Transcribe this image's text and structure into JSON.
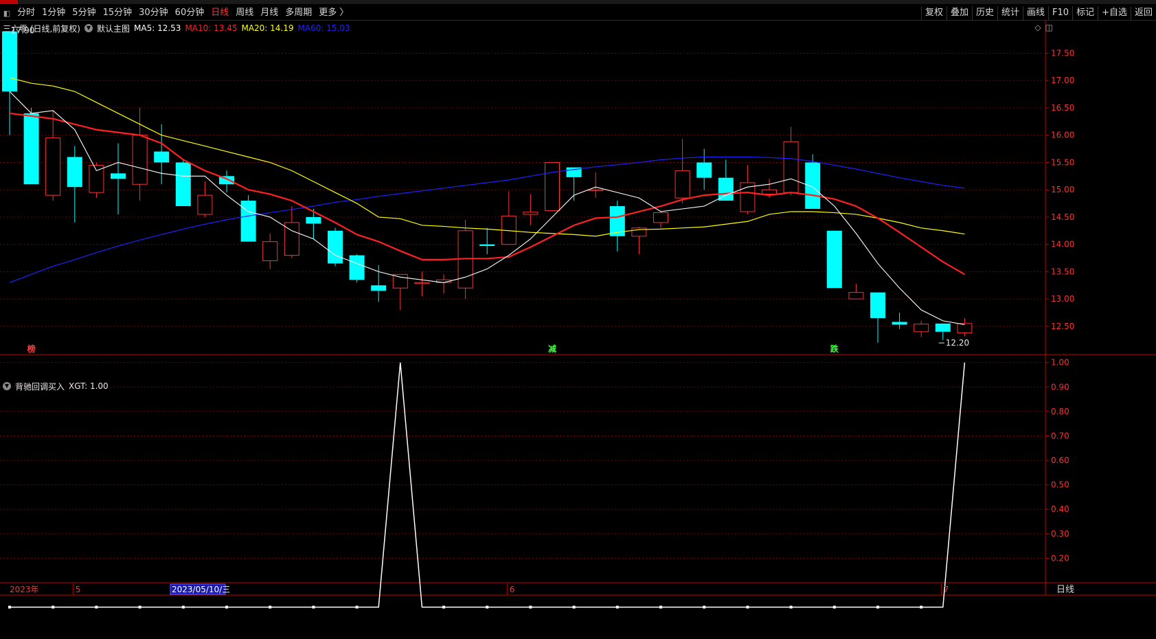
{
  "toolbar": {
    "periods": [
      "分时",
      "1分钟",
      "5分钟",
      "15分钟",
      "30分钟",
      "60分钟",
      "日线",
      "周线",
      "月线",
      "多周期",
      "更多 〉"
    ],
    "active_period": "日线",
    "right_buttons": [
      "复权",
      "叠加",
      "历史",
      "统计",
      "画线",
      "F10",
      "标记",
      "+自选",
      "返回"
    ]
  },
  "main_panel": {
    "stock_title": "三六零 (日线,前复权)",
    "template_label": "默认主图",
    "ma": [
      {
        "label": "MA5: 12.53",
        "color": "#ffffff"
      },
      {
        "label": "MA10: 13.45",
        "color": "#ff2020"
      },
      {
        "label": "MA20: 14.19",
        "color": "#ffff00"
      },
      {
        "label": "MA60: 15.03",
        "color": "#2020ff"
      }
    ],
    "high_label": "17.90",
    "low_label": "12.20",
    "markers": [
      {
        "text": "榜",
        "color": "#ff4040"
      },
      {
        "text": "减",
        "color": "#40ff40"
      },
      {
        "text": "跌",
        "color": "#40ff40"
      }
    ],
    "y_ticks": [
      "17.50",
      "17.00",
      "16.50",
      "16.00",
      "15.50",
      "15.00",
      "14.50",
      "14.00",
      "13.50",
      "13.00",
      "12.50"
    ]
  },
  "sub_panel": {
    "indicator_label": "背驰回调买入",
    "value_label": "XGT: 1.00",
    "y_ticks": [
      "1.00",
      "0.90",
      "0.80",
      "0.70",
      "0.60",
      "0.50",
      "0.40",
      "0.30",
      "0.20"
    ]
  },
  "x_axis": {
    "year_label": "2023年",
    "month_labels": [
      "5",
      "6",
      "7"
    ],
    "cursor_date": "2023/05/10/三",
    "period_label": "日线"
  },
  "colors": {
    "up": "#ff3030",
    "down": "#00ffff",
    "grid": "#7a0000",
    "axis": "#c00000"
  },
  "chart_data": {
    "type": "candlestick",
    "candles": [
      {
        "o": 17.9,
        "h": 17.9,
        "l": 16.0,
        "c": 16.8
      },
      {
        "o": 16.4,
        "h": 16.5,
        "l": 15.1,
        "c": 15.1
      },
      {
        "o": 14.9,
        "h": 16.45,
        "l": 14.8,
        "c": 15.95
      },
      {
        "o": 15.6,
        "h": 15.8,
        "l": 14.4,
        "c": 15.05
      },
      {
        "o": 14.95,
        "h": 15.5,
        "l": 14.85,
        "c": 15.45
      },
      {
        "o": 15.3,
        "h": 15.85,
        "l": 14.55,
        "c": 15.2
      },
      {
        "o": 15.1,
        "h": 16.5,
        "l": 14.8,
        "c": 16.0
      },
      {
        "o": 15.7,
        "h": 16.2,
        "l": 15.1,
        "c": 15.5
      },
      {
        "o": 15.5,
        "h": 15.55,
        "l": 14.7,
        "c": 14.7
      },
      {
        "o": 14.55,
        "h": 15.15,
        "l": 14.5,
        "c": 14.9
      },
      {
        "o": 15.25,
        "h": 15.35,
        "l": 14.95,
        "c": 15.1
      },
      {
        "o": 14.8,
        "h": 14.9,
        "l": 14.05,
        "c": 14.05
      },
      {
        "o": 13.7,
        "h": 14.2,
        "l": 13.55,
        "c": 14.05
      },
      {
        "o": 13.8,
        "h": 14.7,
        "l": 13.75,
        "c": 14.4
      },
      {
        "o": 14.5,
        "h": 14.65,
        "l": 14.1,
        "c": 14.38
      },
      {
        "o": 14.25,
        "h": 14.3,
        "l": 13.6,
        "c": 13.65
      },
      {
        "o": 13.8,
        "h": 13.82,
        "l": 13.3,
        "c": 13.35
      },
      {
        "o": 13.25,
        "h": 13.62,
        "l": 12.95,
        "c": 13.15
      },
      {
        "o": 13.2,
        "h": 13.45,
        "l": 12.8,
        "c": 13.45
      },
      {
        "o": 13.3,
        "h": 13.5,
        "l": 13.05,
        "c": 13.3
      },
      {
        "o": 13.3,
        "h": 13.45,
        "l": 13.1,
        "c": 13.35
      },
      {
        "o": 13.2,
        "h": 14.45,
        "l": 13.0,
        "c": 14.25
      },
      {
        "o": 14.0,
        "h": 14.3,
        "l": 13.82,
        "c": 13.97
      },
      {
        "o": 14.0,
        "h": 14.97,
        "l": 13.99,
        "c": 14.52
      },
      {
        "o": 14.55,
        "h": 14.92,
        "l": 14.35,
        "c": 14.59
      },
      {
        "o": 14.62,
        "h": 15.5,
        "l": 14.6,
        "c": 15.5
      },
      {
        "o": 15.41,
        "h": 15.41,
        "l": 14.8,
        "c": 15.23
      },
      {
        "o": 15.0,
        "h": 15.32,
        "l": 14.85,
        "c": 15.0
      },
      {
        "o": 14.7,
        "h": 14.8,
        "l": 13.87,
        "c": 14.15
      },
      {
        "o": 14.15,
        "h": 14.32,
        "l": 13.82,
        "c": 14.3
      },
      {
        "o": 14.4,
        "h": 14.62,
        "l": 14.3,
        "c": 14.58
      },
      {
        "o": 14.85,
        "h": 15.93,
        "l": 14.75,
        "c": 15.35
      },
      {
        "o": 15.5,
        "h": 15.75,
        "l": 15.0,
        "c": 15.22
      },
      {
        "o": 15.22,
        "h": 15.55,
        "l": 14.8,
        "c": 14.8
      },
      {
        "o": 14.6,
        "h": 15.45,
        "l": 14.55,
        "c": 15.13
      },
      {
        "o": 14.92,
        "h": 15.2,
        "l": 14.85,
        "c": 15.0
      },
      {
        "o": 14.95,
        "h": 16.15,
        "l": 14.9,
        "c": 15.88
      },
      {
        "o": 15.5,
        "h": 15.65,
        "l": 14.65,
        "c": 14.65
      },
      {
        "o": 14.25,
        "h": 14.25,
        "l": 13.2,
        "c": 13.2
      },
      {
        "o": 13.0,
        "h": 13.28,
        "l": 13.0,
        "c": 13.12
      },
      {
        "o": 13.12,
        "h": 13.12,
        "l": 12.2,
        "c": 12.65
      },
      {
        "o": 12.58,
        "h": 12.75,
        "l": 12.45,
        "c": 12.53
      },
      {
        "o": 12.4,
        "h": 12.6,
        "l": 12.3,
        "c": 12.54
      },
      {
        "o": 12.55,
        "h": 12.55,
        "l": 12.25,
        "c": 12.4
      },
      {
        "o": 12.38,
        "h": 12.65,
        "l": 12.32,
        "c": 12.55
      }
    ],
    "ma5": [
      16.8,
      16.4,
      16.45,
      16.1,
      15.35,
      15.5,
      15.4,
      15.3,
      15.25,
      15.25,
      14.9,
      14.6,
      14.5,
      14.25,
      14.1,
      13.8,
      13.65,
      13.5,
      13.4,
      13.35,
      13.3,
      13.4,
      13.55,
      13.8,
      14.1,
      14.5,
      14.9,
      15.05,
      14.95,
      14.85,
      14.6,
      14.65,
      14.7,
      14.9,
      15.05,
      15.1,
      15.2,
      15.05,
      14.7,
      14.2,
      13.65,
      13.2,
      12.8,
      12.6,
      12.53
    ],
    "ma10": [
      16.4,
      16.35,
      16.3,
      16.2,
      16.1,
      16.05,
      16.0,
      15.85,
      15.55,
      15.35,
      15.2,
      15.0,
      14.92,
      14.8,
      14.6,
      14.4,
      14.18,
      14.05,
      13.88,
      13.72,
      13.72,
      13.74,
      13.74,
      13.77,
      13.95,
      14.15,
      14.35,
      14.48,
      14.5,
      14.6,
      14.7,
      14.82,
      14.9,
      14.93,
      14.95,
      14.9,
      14.95,
      14.9,
      14.83,
      14.7,
      14.48,
      14.22,
      13.95,
      13.68,
      13.45
    ],
    "ma20": [
      17.05,
      16.95,
      16.9,
      16.8,
      16.6,
      16.4,
      16.2,
      16.0,
      15.9,
      15.8,
      15.7,
      15.6,
      15.5,
      15.35,
      15.15,
      14.95,
      14.75,
      14.5,
      14.47,
      14.35,
      14.33,
      14.3,
      14.28,
      14.25,
      14.22,
      14.2,
      14.18,
      14.15,
      14.22,
      14.27,
      14.28,
      14.3,
      14.32,
      14.37,
      14.42,
      14.55,
      14.6,
      14.6,
      14.58,
      14.55,
      14.48,
      14.4,
      14.3,
      14.25,
      14.19
    ],
    "ma60": [
      13.3,
      13.45,
      13.6,
      13.72,
      13.85,
      13.97,
      14.08,
      14.18,
      14.28,
      14.37,
      14.45,
      14.52,
      14.58,
      14.64,
      14.7,
      14.77,
      14.82,
      14.88,
      14.93,
      14.98,
      15.03,
      15.08,
      15.13,
      15.18,
      15.25,
      15.32,
      15.37,
      15.42,
      15.46,
      15.5,
      15.55,
      15.58,
      15.6,
      15.6,
      15.6,
      15.59,
      15.57,
      15.52,
      15.45,
      15.38,
      15.3,
      15.22,
      15.15,
      15.08,
      15.03
    ],
    "xgt": [
      0,
      0,
      0,
      0,
      0,
      0,
      0,
      0,
      0,
      0,
      0,
      0,
      0,
      0,
      0,
      0,
      0,
      0,
      1,
      0,
      0,
      0,
      0,
      0,
      0,
      0,
      0,
      0,
      0,
      0,
      0,
      0,
      0,
      0,
      0,
      0,
      0,
      0,
      0,
      0,
      0,
      0,
      0,
      0,
      1
    ],
    "main_ylim": [
      12.02,
      18.06
    ],
    "sub_ylim": [
      0.1,
      1.03
    ]
  }
}
